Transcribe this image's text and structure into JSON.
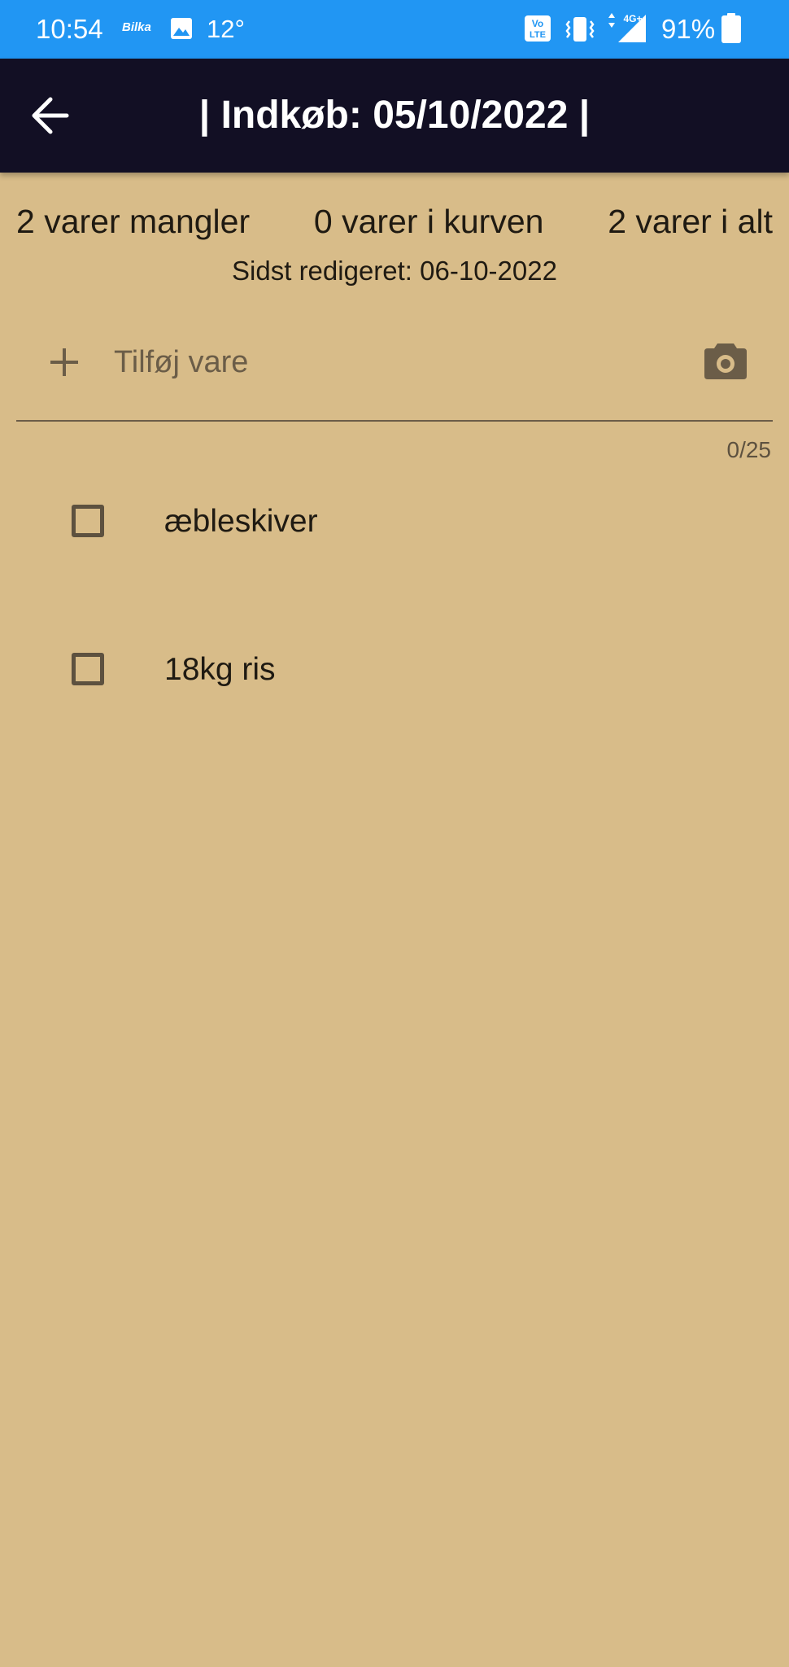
{
  "status_bar": {
    "time": "10:54",
    "app_badge": "Bilka",
    "temperature": "12°",
    "battery_percent": "91%",
    "network_label": "4G+",
    "volte_label_top": "Vo",
    "volte_label_bottom": "LTE",
    "background_color": "#2196F3"
  },
  "app_bar": {
    "title": "| Indkøb: 05/10/2022 |",
    "back_icon": "arrow-back-icon",
    "background_color": "#120F24"
  },
  "summary": {
    "missing": "2 varer mangler",
    "in_basket": "0 varer i kurven",
    "total": "2 varer i alt",
    "last_edited": "Sidst redigeret: 06-10-2022"
  },
  "add_item": {
    "placeholder": "Tilføj vare",
    "counter": "0/25",
    "add_icon": "plus-icon",
    "camera_icon": "camera-icon"
  },
  "items": [
    {
      "label": "æbleskiver",
      "checked": false
    },
    {
      "label": "18kg ris",
      "checked": false
    }
  ],
  "theme": {
    "page_background": "#D8BC89",
    "icon_color": "#6b5d48"
  }
}
